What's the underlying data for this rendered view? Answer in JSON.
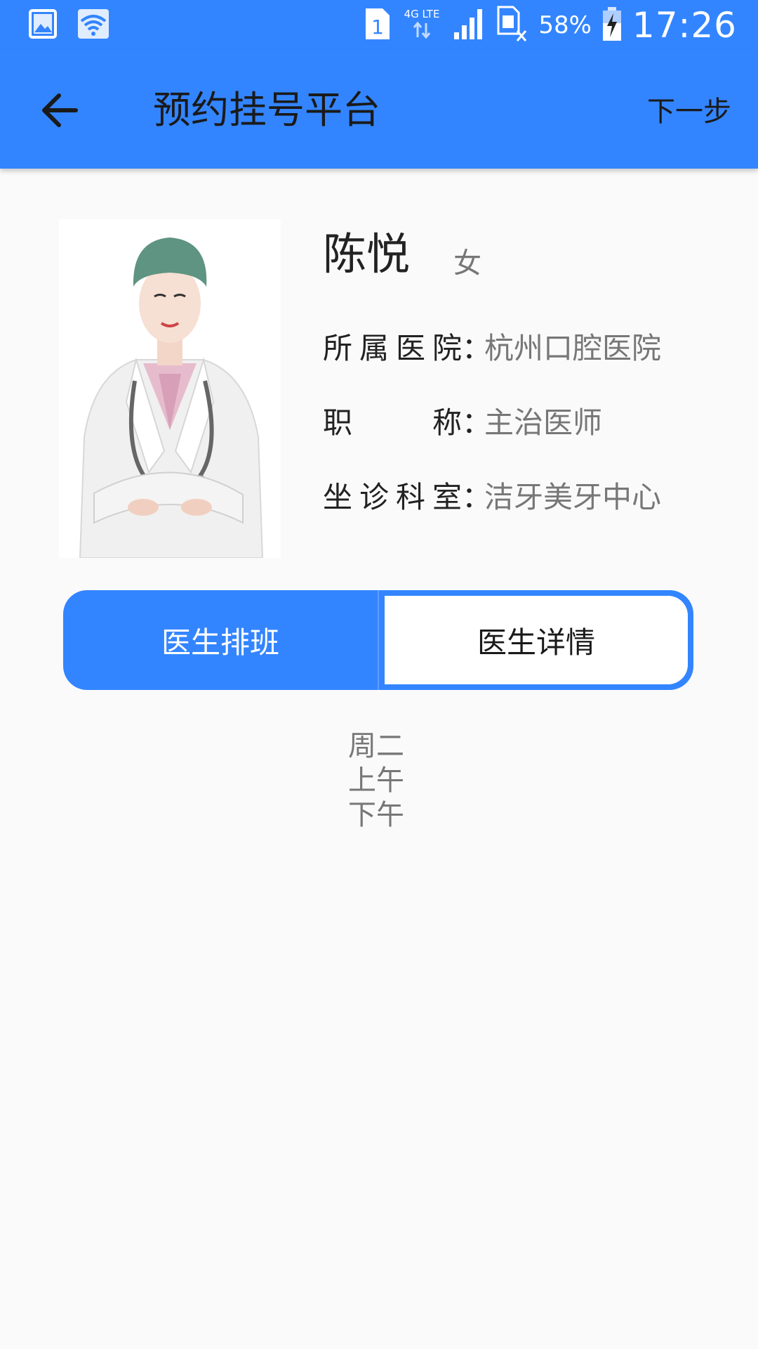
{
  "status_bar": {
    "sim": "1",
    "network": "4G LTE",
    "battery_percent": "58%",
    "time": "17:26",
    "icons": [
      "gallery-icon",
      "wifi-icon",
      "sim-icon",
      "lte-icon",
      "signal-icon",
      "no-sim-icon",
      "battery-charging-icon"
    ]
  },
  "app_bar": {
    "title": "预约挂号平台",
    "next_label": "下一步"
  },
  "doctor": {
    "name": "陈悦",
    "gender": "女",
    "hospital_label": [
      "所",
      "属",
      "医",
      "院"
    ],
    "hospital_value": "杭州口腔医院",
    "title_label": [
      "职",
      "称"
    ],
    "title_value": "主治医师",
    "department_label": [
      "坐",
      "诊",
      "科",
      "室"
    ],
    "department_value": "洁牙美牙中心",
    "colon": "："
  },
  "tabs": {
    "schedule_label": "医生排班",
    "details_label": "医生详情"
  },
  "schedule": {
    "day": "周二",
    "morning": "上午",
    "afternoon": "下午"
  },
  "colors": {
    "primary": "#3385ff",
    "background": "#fafafa",
    "text_dark": "#222222",
    "text_grey": "#777777"
  }
}
